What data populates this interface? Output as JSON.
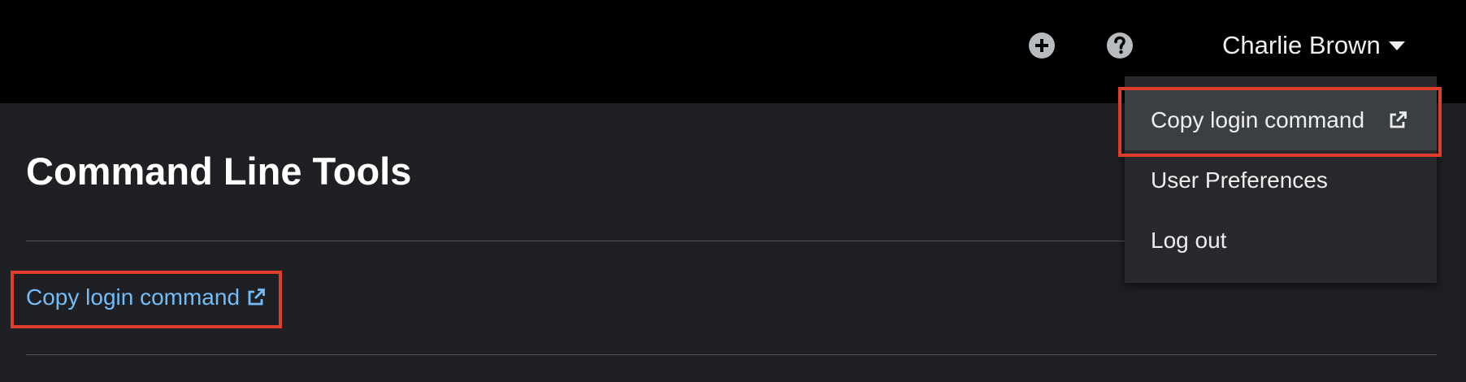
{
  "masthead": {
    "add_icon": "plus-circle-icon",
    "help_icon": "question-circle-icon",
    "user_name": "Charlie Brown"
  },
  "page": {
    "title": "Command Line Tools",
    "copy_link_label": "Copy login command"
  },
  "user_dropdown": {
    "items": [
      {
        "label": "Copy login command",
        "icon": "external-link-icon"
      },
      {
        "label": "User Preferences"
      },
      {
        "label": "Log out"
      }
    ]
  },
  "colors": {
    "masthead_bg": "#000000",
    "page_bg": "#1f2024",
    "link": "#73bcf7",
    "highlight": "#e03e2d",
    "dropdown_bg": "#28292d",
    "dropdown_hover": "#3c3f42"
  }
}
